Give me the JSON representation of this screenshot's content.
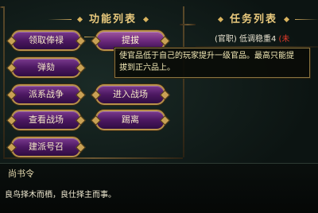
{
  "panels": {
    "functions_title": "功能列表",
    "tasks_title": "任务列表"
  },
  "functions": [
    {
      "id": "salary",
      "label": "领取俸禄"
    },
    {
      "id": "promote",
      "label": "提拔"
    },
    {
      "id": "impeach",
      "label": "弹劾"
    },
    {
      "id": "faction_war",
      "label": "派系战争"
    },
    {
      "id": "enter_battle",
      "label": "进入战场"
    },
    {
      "id": "view_battle",
      "label": "查看战场"
    },
    {
      "id": "dispatch",
      "label": "踢离"
    },
    {
      "id": "summon",
      "label": "建派号召"
    }
  ],
  "task": {
    "text": "(官职) 低调稳重4",
    "flag": "(未"
  },
  "tooltip": {
    "line1": "使官品低于自己的玩家提升一级官品。最高只能提",
    "line2": "拔到正六品上。"
  },
  "dialog": {
    "npc_name": "尚书令",
    "quote": "良鸟择木而栖，良仕择主而事。"
  }
}
